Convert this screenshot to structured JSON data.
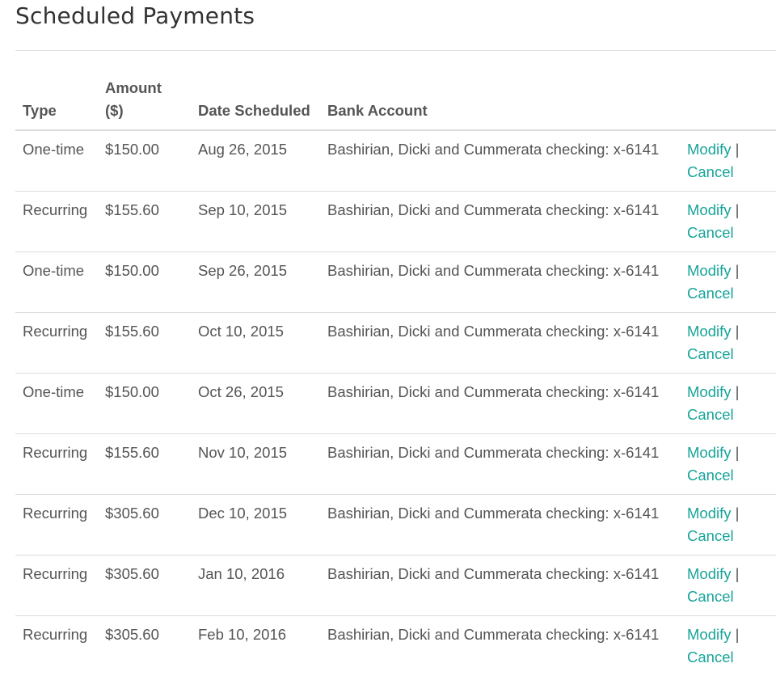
{
  "page": {
    "title": "Scheduled Payments"
  },
  "table": {
    "headers": {
      "type": "Type",
      "amount": "Amount ($)",
      "date": "Date Scheduled",
      "bank": "Bank Account",
      "actions": ""
    },
    "rows": [
      {
        "type": "One-time",
        "amount": "$150.00",
        "date": "Aug 26, 2015",
        "bank": "Bashirian, Dicki and Cummerata checking: x-6141",
        "modify": "Modify",
        "sep": "|",
        "cancel": "Cancel"
      },
      {
        "type": "Recurring",
        "amount": "$155.60",
        "date": "Sep 10, 2015",
        "bank": "Bashirian, Dicki and Cummerata checking: x-6141",
        "modify": "Modify",
        "sep": "|",
        "cancel": "Cancel"
      },
      {
        "type": "One-time",
        "amount": "$150.00",
        "date": "Sep 26, 2015",
        "bank": "Bashirian, Dicki and Cummerata checking: x-6141",
        "modify": "Modify",
        "sep": "|",
        "cancel": "Cancel"
      },
      {
        "type": "Recurring",
        "amount": "$155.60",
        "date": "Oct 10, 2015",
        "bank": "Bashirian, Dicki and Cummerata checking: x-6141",
        "modify": "Modify",
        "sep": "|",
        "cancel": "Cancel"
      },
      {
        "type": "One-time",
        "amount": "$150.00",
        "date": "Oct 26, 2015",
        "bank": "Bashirian, Dicki and Cummerata checking: x-6141",
        "modify": "Modify",
        "sep": "|",
        "cancel": "Cancel"
      },
      {
        "type": "Recurring",
        "amount": "$155.60",
        "date": "Nov 10, 2015",
        "bank": "Bashirian, Dicki and Cummerata checking: x-6141",
        "modify": "Modify",
        "sep": "|",
        "cancel": "Cancel"
      },
      {
        "type": "Recurring",
        "amount": "$305.60",
        "date": "Dec 10, 2015",
        "bank": "Bashirian, Dicki and Cummerata checking: x-6141",
        "modify": "Modify",
        "sep": "|",
        "cancel": "Cancel"
      },
      {
        "type": "Recurring",
        "amount": "$305.60",
        "date": "Jan 10, 2016",
        "bank": "Bashirian, Dicki and Cummerata checking: x-6141",
        "modify": "Modify",
        "sep": "|",
        "cancel": "Cancel"
      },
      {
        "type": "Recurring",
        "amount": "$305.60",
        "date": "Feb 10, 2016",
        "bank": "Bashirian, Dicki and Cummerata checking: x-6141",
        "modify": "Modify",
        "sep": "|",
        "cancel": "Cancel"
      }
    ]
  },
  "colors": {
    "link": "#18a49a",
    "text": "#555555",
    "title": "#333333",
    "rule": "#dddddd"
  }
}
